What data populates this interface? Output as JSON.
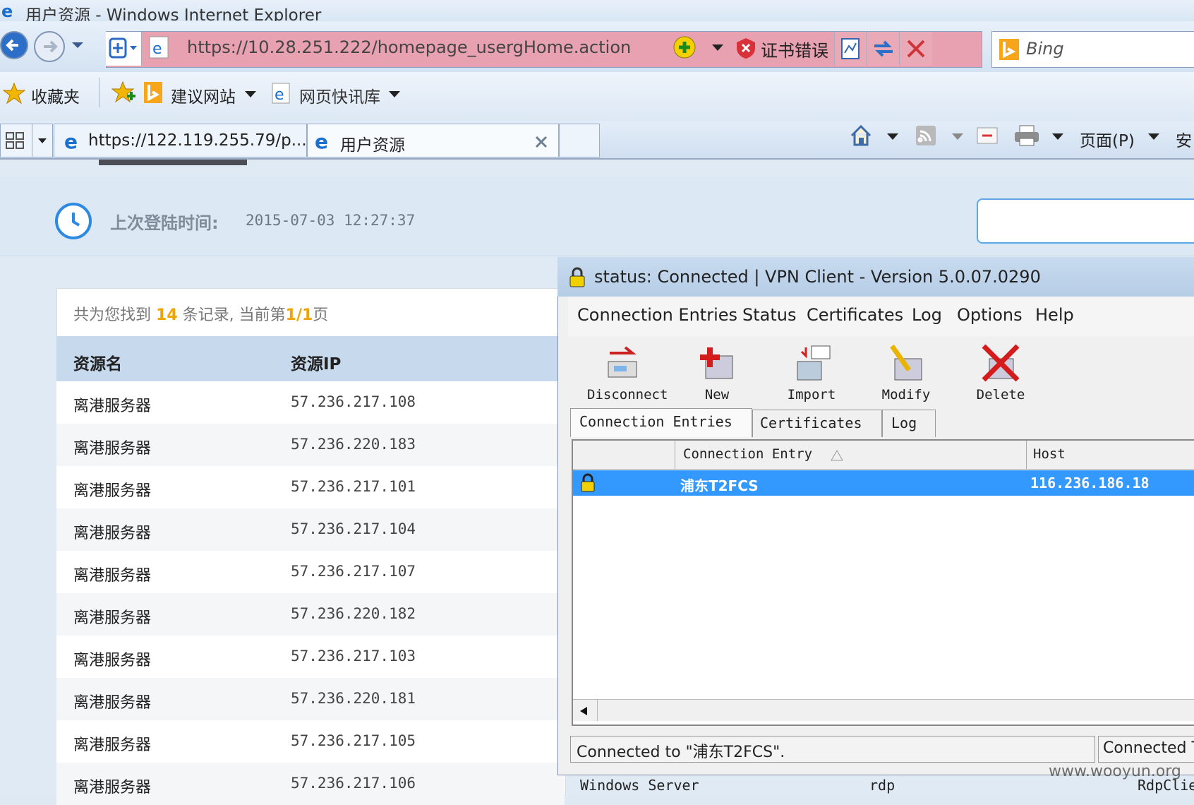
{
  "window": {
    "title": "用户资源 - Windows Internet Explorer"
  },
  "address": {
    "url": "https://10.28.251.222/homepage_usergHome.action",
    "cert_error": "证书错误",
    "search_placeholder": "Bing"
  },
  "favorites": {
    "label": "收藏夹",
    "suggested": "建议网站",
    "webslice": "网页快讯库"
  },
  "tabs": [
    {
      "label": "https://122.119.255.79/p..."
    },
    {
      "label": "用户资源"
    }
  ],
  "commandbar": {
    "page_label": "页面(P)",
    "safety_label": "安"
  },
  "page": {
    "last_login_label": "上次登陆时间:",
    "last_login_value": "2015-07-03 12:27:37",
    "records_prefix": "共为您找到",
    "records_count": "14",
    "records_middle": "条记录, 当前第",
    "records_page": "1/1",
    "records_suffix": "页",
    "columns": [
      "资源名",
      "资源IP"
    ],
    "rows": [
      [
        "离港服务器",
        "57.236.217.108"
      ],
      [
        "离港服务器",
        "57.236.220.183"
      ],
      [
        "离港服务器",
        "57.236.217.101"
      ],
      [
        "离港服务器",
        "57.236.217.104"
      ],
      [
        "离港服务器",
        "57.236.217.107"
      ],
      [
        "离港服务器",
        "57.236.220.182"
      ],
      [
        "离港服务器",
        "57.236.217.103"
      ],
      [
        "离港服务器",
        "57.236.220.181"
      ],
      [
        "离港服务器",
        "57.236.217.105"
      ],
      [
        "离港服务器",
        "57.236.217.106"
      ]
    ]
  },
  "vpn": {
    "title": "status: Connected | VPN Client - Version 5.0.07.0290",
    "menu": [
      "Connection Entries",
      "Status",
      "Certificates",
      "Log",
      "Options",
      "Help"
    ],
    "toolbar": [
      "Disconnect",
      "New",
      "Import",
      "Modify",
      "Delete"
    ],
    "tabs": [
      "Connection Entries",
      "Certificates",
      "Log"
    ],
    "columns": [
      "Connection Entry",
      "Host"
    ],
    "entry": {
      "name": "浦东T2FCS",
      "host": "116.236.186.18"
    },
    "status_left": "Connected to \"浦东T2FCS\".",
    "status_right": "Connected T"
  },
  "background_row": {
    "a": "Windows Server",
    "b": "rdp",
    "c": "RdpClie"
  },
  "watermark": "www.wooyun.org"
}
